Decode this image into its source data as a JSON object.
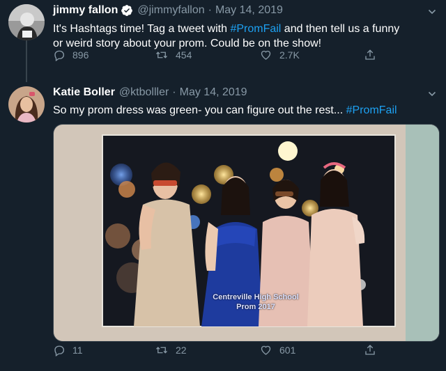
{
  "tweet1": {
    "author_name": "jimmy fallon",
    "handle": "@jimmyfallon",
    "separator": "·",
    "date": "May 14, 2019",
    "text_before": "It's Hashtags time! Tag a tweet with ",
    "hashtag": "#PromFail",
    "text_line1_after": " and then tell us a funny",
    "text_line2": "or weird story about your prom. Could be on the show!",
    "replies": "896",
    "retweets": "454",
    "likes": "2.7K"
  },
  "tweet2": {
    "author_name": "Katie Boller",
    "handle": "@ktbolller",
    "separator": "·",
    "date": "May 14, 2019",
    "text": "So my prom dress was green- you can figure out the rest... ",
    "hashtag": "#PromFail",
    "photo_caption_line1": "Centreville High School",
    "photo_caption_line2": "Prom 2017",
    "replies": "11",
    "retweets": "22",
    "likes": "601"
  },
  "colors": {
    "background": "#15202b",
    "link": "#1da1f2",
    "muted": "#8899a6",
    "verified": "#ffffff"
  },
  "icons": {
    "reply": "reply-icon",
    "retweet": "retweet-icon",
    "like": "heart-icon",
    "share": "share-icon",
    "verified": "verified-badge-icon",
    "more": "chevron-down-icon"
  }
}
